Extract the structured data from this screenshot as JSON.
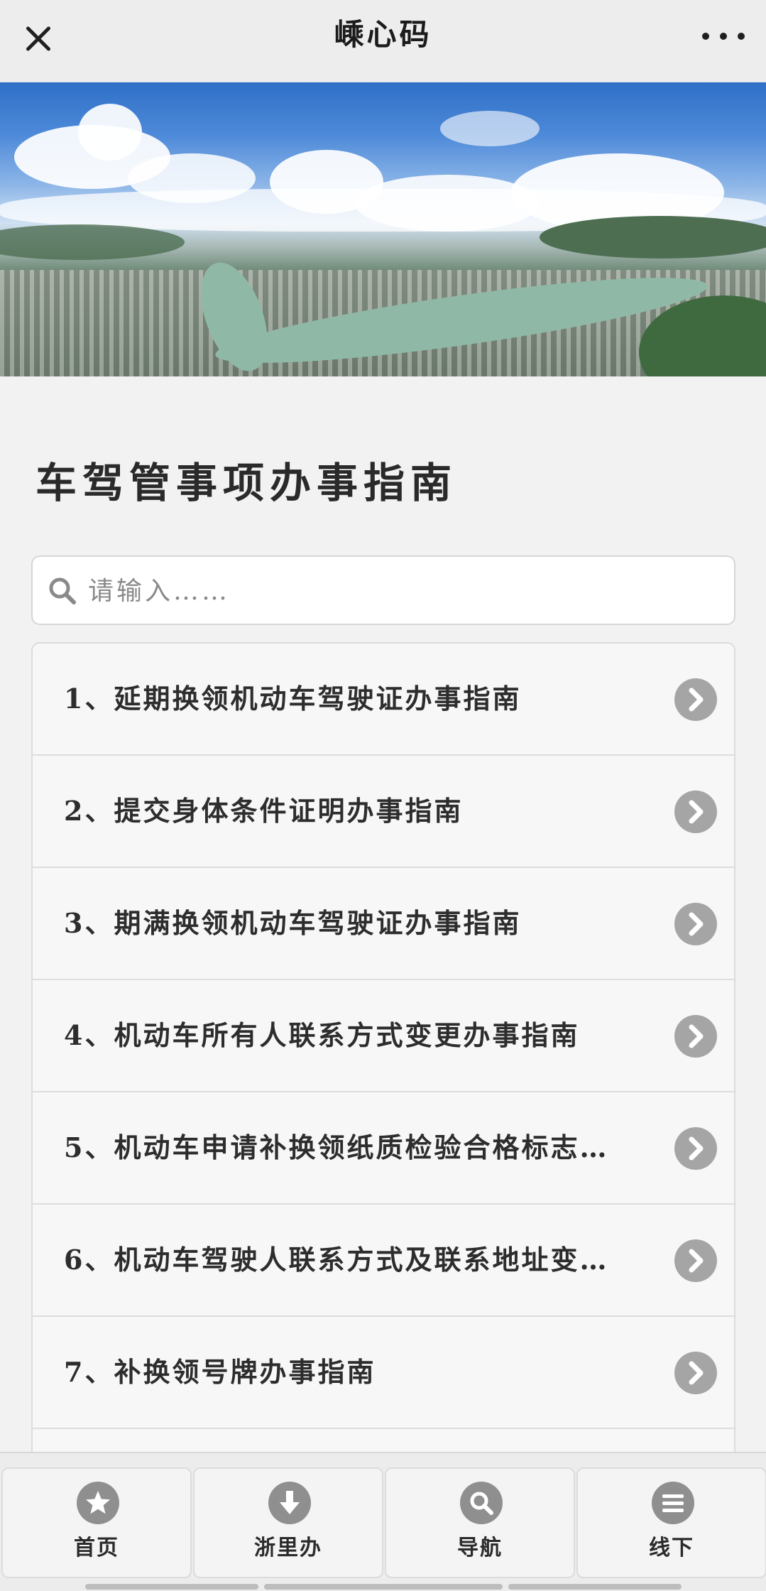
{
  "header": {
    "title": "嵊心码",
    "close_icon": "close-icon",
    "more_icon": "more-dots-icon"
  },
  "banner": {
    "image": "aerial city river panorama"
  },
  "main": {
    "title": "车驾管事项办事指南",
    "search": {
      "placeholder": "请输入……",
      "value": ""
    },
    "items": [
      {
        "label": "1、延期换领机动车驾驶证办事指南"
      },
      {
        "label": "2、提交身体条件证明办事指南"
      },
      {
        "label": "3、期满换领机动车驾驶证办事指南"
      },
      {
        "label": "4、机动车所有人联系方式变更办事指南"
      },
      {
        "label": "5、机动车申请补换领纸质检验合格标志…"
      },
      {
        "label": "6、机动车驾驶人联系方式及联系地址变…"
      },
      {
        "label": "7、补换领号牌办事指南"
      }
    ]
  },
  "tabbar": {
    "tabs": [
      {
        "label": "首页",
        "icon": "star-icon"
      },
      {
        "label": "浙里办",
        "icon": "download-arrow-icon"
      },
      {
        "label": "导航",
        "icon": "search-icon"
      },
      {
        "label": "线下",
        "icon": "menu-lines-icon"
      }
    ]
  },
  "colors": {
    "background": "#f2f2f2",
    "icon_gray": "#a5a5a5",
    "text": "#2b2b2b"
  }
}
